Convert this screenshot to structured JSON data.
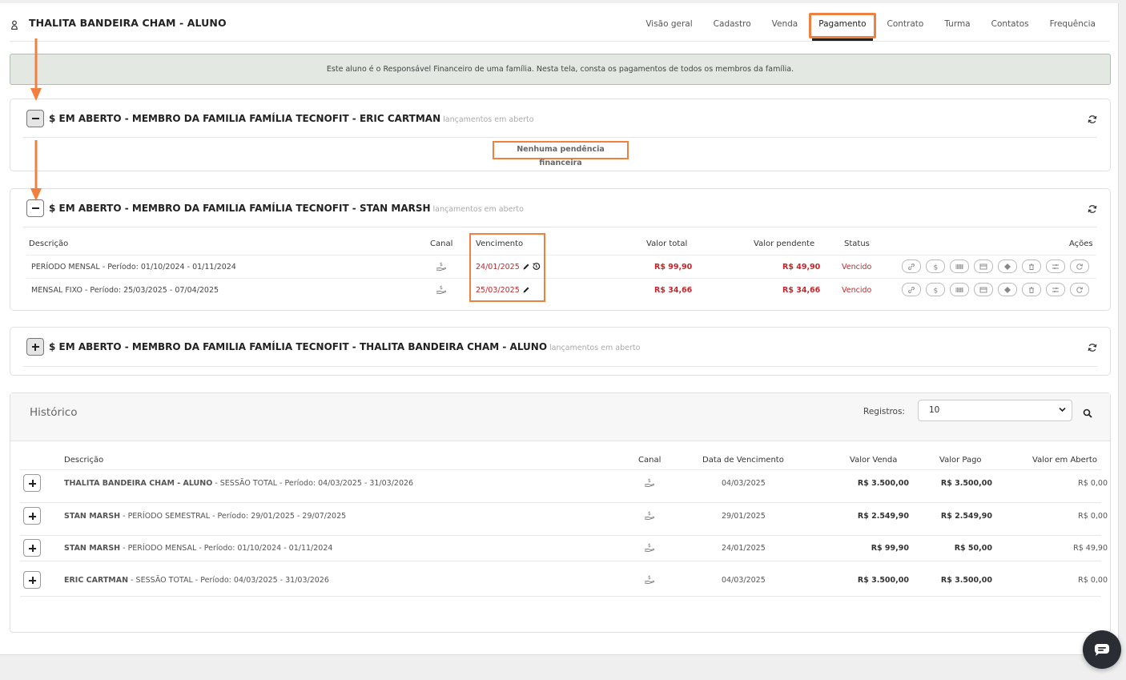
{
  "header": {
    "student_name": "THALITA BANDEIRA CHAM - ALUNO",
    "tabs": [
      {
        "label": "Visão geral"
      },
      {
        "label": "Cadastro"
      },
      {
        "label": "Venda"
      },
      {
        "label": "Pagamento",
        "active": true
      },
      {
        "label": "Contrato"
      },
      {
        "label": "Turma"
      },
      {
        "label": "Contatos"
      },
      {
        "label": "Frequência"
      }
    ]
  },
  "alert": {
    "text": "Este aluno é o Responsável Financeiro de uma família. Nesta tela, consta os pagamentos de todos os membros da família."
  },
  "panels": [
    {
      "title": "$ EM ABERTO - MEMBRO DA FAMILIA FAMÍLIA TECNOFIT - ERIC CARTMAN",
      "subtitle": "lançamentos em aberto",
      "expanded": true,
      "empty_message": "Nenhuma pendência financeira"
    },
    {
      "title": "$ EM ABERTO - MEMBRO DA FAMILIA FAMÍLIA TECNOFIT - STAN MARSH",
      "subtitle": "lançamentos em aberto",
      "expanded": true,
      "columns": {
        "descricao": "Descrição",
        "canal": "Canal",
        "vencimento": "Vencimento",
        "valor_total": "Valor total",
        "valor_pendente": "Valor pendente",
        "status": "Status",
        "acoes": "Ações"
      },
      "rows": [
        {
          "descricao": "PERÍODO MENSAL - Período: 01/10/2024 - 01/11/2024",
          "vencimento": "24/01/2025",
          "valor_total": "R$ 99,90",
          "valor_pendente": "R$ 49,90",
          "status": "Vencido"
        },
        {
          "descricao": "MENSAL FIXO - Período: 25/03/2025 - 07/04/2025",
          "vencimento": "25/03/2025",
          "valor_total": "R$ 34,66",
          "valor_pendente": "R$ 34,66",
          "status": "Vencido"
        }
      ],
      "action_icons": [
        "link-icon",
        "dollar-icon",
        "barcode-icon",
        "credit-card-icon",
        "pix-icon",
        "trash-icon",
        "sliders-icon",
        "refresh-icon"
      ]
    },
    {
      "title": "$ EM ABERTO - MEMBRO DA FAMILIA FAMÍLIA TECNOFIT - THALITA BANDEIRA CHAM - ALUNO",
      "subtitle": "lançamentos em aberto",
      "expanded": false
    }
  ],
  "history": {
    "title": "Histórico",
    "registros_label": "Registros:",
    "registros_value": "10",
    "columns": {
      "descricao": "Descrição",
      "canal": "Canal",
      "data_vencimento": "Data de Vencimento",
      "valor_venda": "Valor Venda",
      "valor_pago": "Valor Pago",
      "valor_aberto": "Valor em Aberto"
    },
    "rows": [
      {
        "nome": "THALITA BANDEIRA CHAM - ALUNO",
        "detalhe": " - SESSÃO TOTAL - Período: 04/03/2025 - 31/03/2026",
        "data": "04/03/2025",
        "venda": "R$ 3.500,00",
        "pago": "R$ 3.500,00",
        "aberto": "R$ 0,00",
        "aberto_alert": false
      },
      {
        "nome": "STAN MARSH",
        "detalhe": " - PERÍODO SEMESTRAL - Período: 29/01/2025 - 29/07/2025",
        "data": "29/01/2025",
        "venda": "R$ 2.549,90",
        "pago": "R$ 2.549,90",
        "aberto": "R$ 0,00",
        "aberto_alert": false
      },
      {
        "nome": "STAN MARSH",
        "detalhe": " - PERÍODO MENSAL - Período: 01/10/2024 - 01/11/2024",
        "data": "24/01/2025",
        "venda": "R$ 99,90",
        "pago": "R$ 50,00",
        "aberto": "R$ 49,90",
        "aberto_alert": true
      },
      {
        "nome": "ERIC CARTMAN",
        "detalhe": " - SESSÃO TOTAL - Período: 04/03/2025 - 31/03/2026",
        "data": "04/03/2025",
        "venda": "R$ 3.500,00",
        "pago": "R$ 3.500,00",
        "aberto": "R$ 0,00",
        "aberto_alert": false
      }
    ]
  },
  "colors": {
    "highlight": "#f08040",
    "overdue": "#c0282d"
  }
}
